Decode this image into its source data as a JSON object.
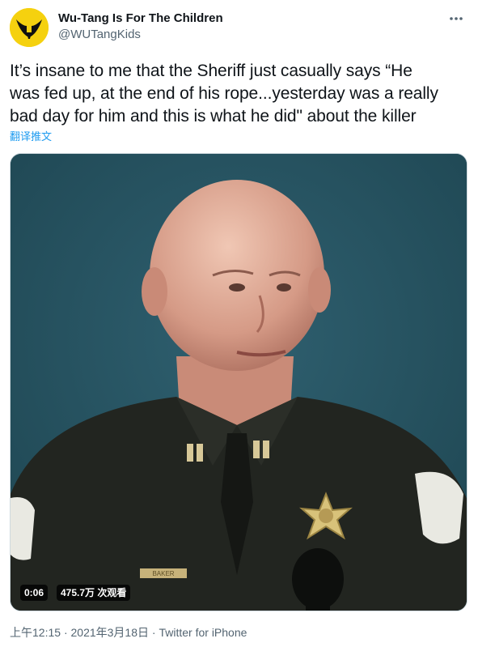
{
  "author": {
    "display_name": "Wu-Tang Is For The Children",
    "handle": "@WUTangKids"
  },
  "tweet": {
    "text_lines": [
      "It’s insane to me that the Sheriff just casually says “He",
      "was fed up, at the end of his rope...yesterday was a really",
      "bad day for him and this is what he did\" about the killer"
    ],
    "translate_label": "翻译推文"
  },
  "video": {
    "timestamp": "0:06",
    "views": "475.7万 次观看",
    "nameplate": "BAKER"
  },
  "meta": {
    "time": "上午12:15",
    "separator": "·",
    "date": "2021年3月18日",
    "source": "Twitter for iPhone"
  },
  "icons": {
    "avatar": "wu-tang-logo",
    "more": "more-horizontal-icon"
  },
  "colors": {
    "avatar_bg": "#f5d10f",
    "link": "#1d9bf0",
    "secondary_text": "#536471",
    "video_background": "#26525f"
  }
}
